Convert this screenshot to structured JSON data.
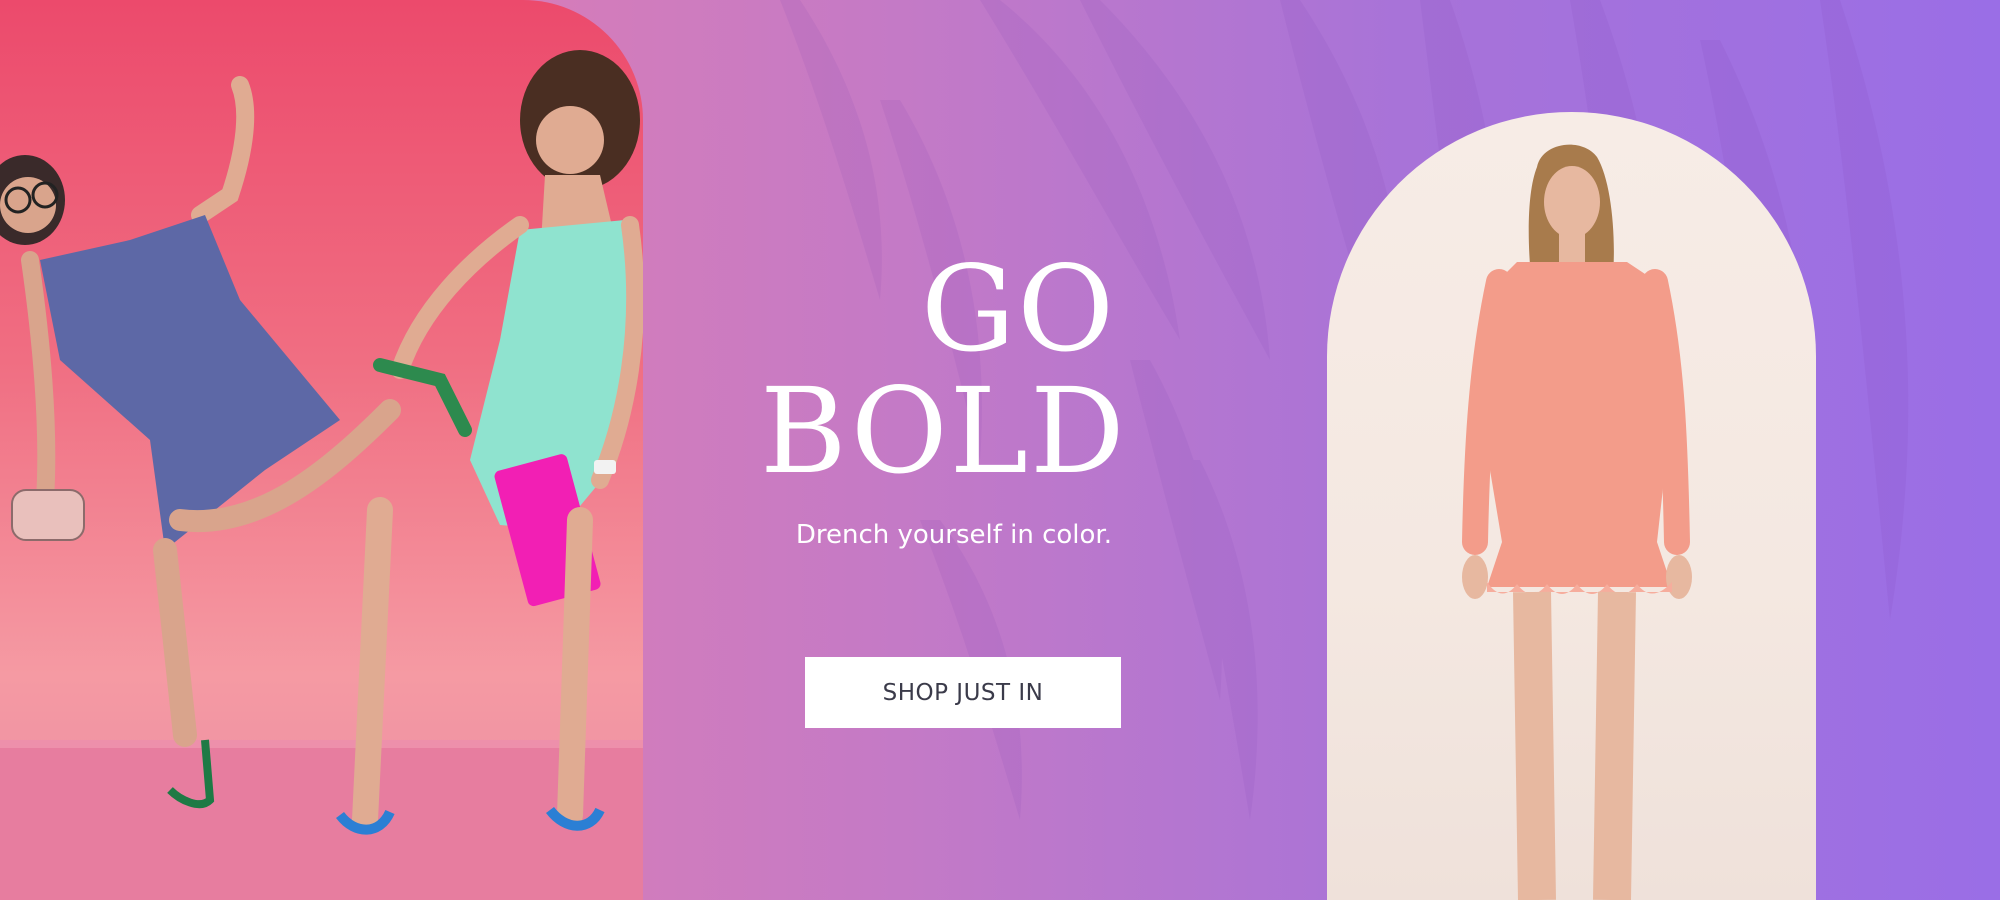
{
  "hero": {
    "headline_line1": "GO",
    "headline_line2": "BOLD",
    "subtitle": "Drench yourself in color.",
    "cta_label": "SHOP JUST IN"
  },
  "colors": {
    "gradient_left": "#e07fb0",
    "gradient_right": "#9a6ee6",
    "cta_background": "#ffffff",
    "cta_text": "#3b3b4a",
    "text": "#ffffff"
  }
}
